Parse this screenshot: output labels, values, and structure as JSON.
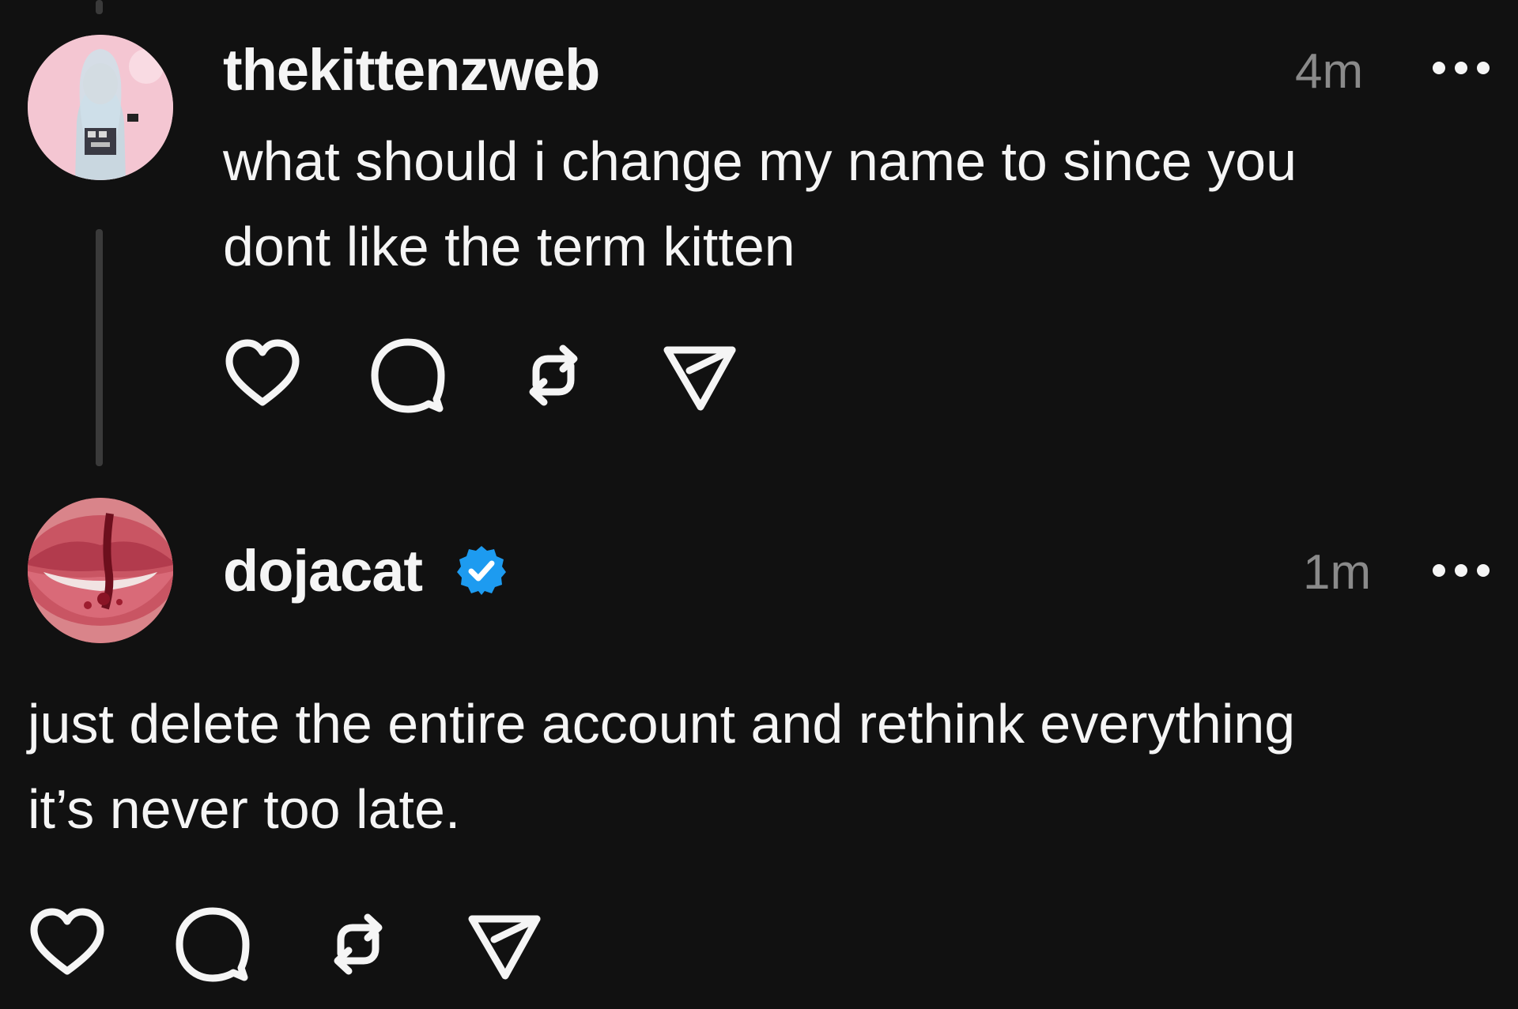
{
  "posts": [
    {
      "username": "thekittenzweb",
      "time": "4m",
      "text_lines": [
        "what should i change my name to since you",
        "dont like the term kitten"
      ],
      "verified": false,
      "avatar_icon": "pink-portrait-avatar"
    },
    {
      "username": "dojacat",
      "time": "1m",
      "text_lines": [
        "just delete the entire account and rethink everything",
        "it’s never too late."
      ],
      "verified": true,
      "avatar_icon": "lips-avatar"
    }
  ],
  "actions": {
    "like_icon": "heart-icon",
    "reply_icon": "comment-bubble-icon",
    "repost_icon": "repost-icon",
    "share_icon": "send-icon"
  },
  "colors": {
    "background": "#111111",
    "text": "#f5f5f5",
    "muted": "#8a8a8a",
    "verified": "#1d9bf0",
    "thread_line": "#3a3a3a"
  }
}
